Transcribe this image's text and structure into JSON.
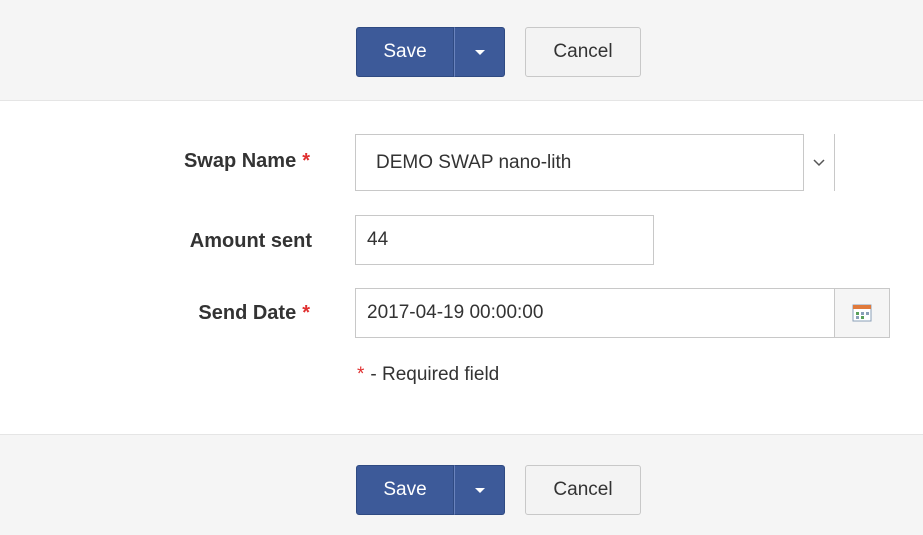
{
  "toolbar": {
    "save_label": "Save",
    "cancel_label": "Cancel"
  },
  "form": {
    "swap_name": {
      "label": "Swap Name",
      "required_marker": "*",
      "value": "DEMO SWAP nano-lith"
    },
    "amount_sent": {
      "label": "Amount sent",
      "value": "44"
    },
    "send_date": {
      "label": "Send Date",
      "required_marker": "*",
      "value": "2017-04-19 00:00:00"
    },
    "required_note": {
      "marker": "*",
      "text": "- Required field"
    }
  },
  "colors": {
    "primary_button": "#3d5a99",
    "required_marker": "#e02f2f",
    "bar_background": "#f5f5f5"
  },
  "icons": {
    "dropdown": "chevron-down-icon",
    "split_button": "caret-down-icon",
    "calendar": "calendar-icon"
  }
}
